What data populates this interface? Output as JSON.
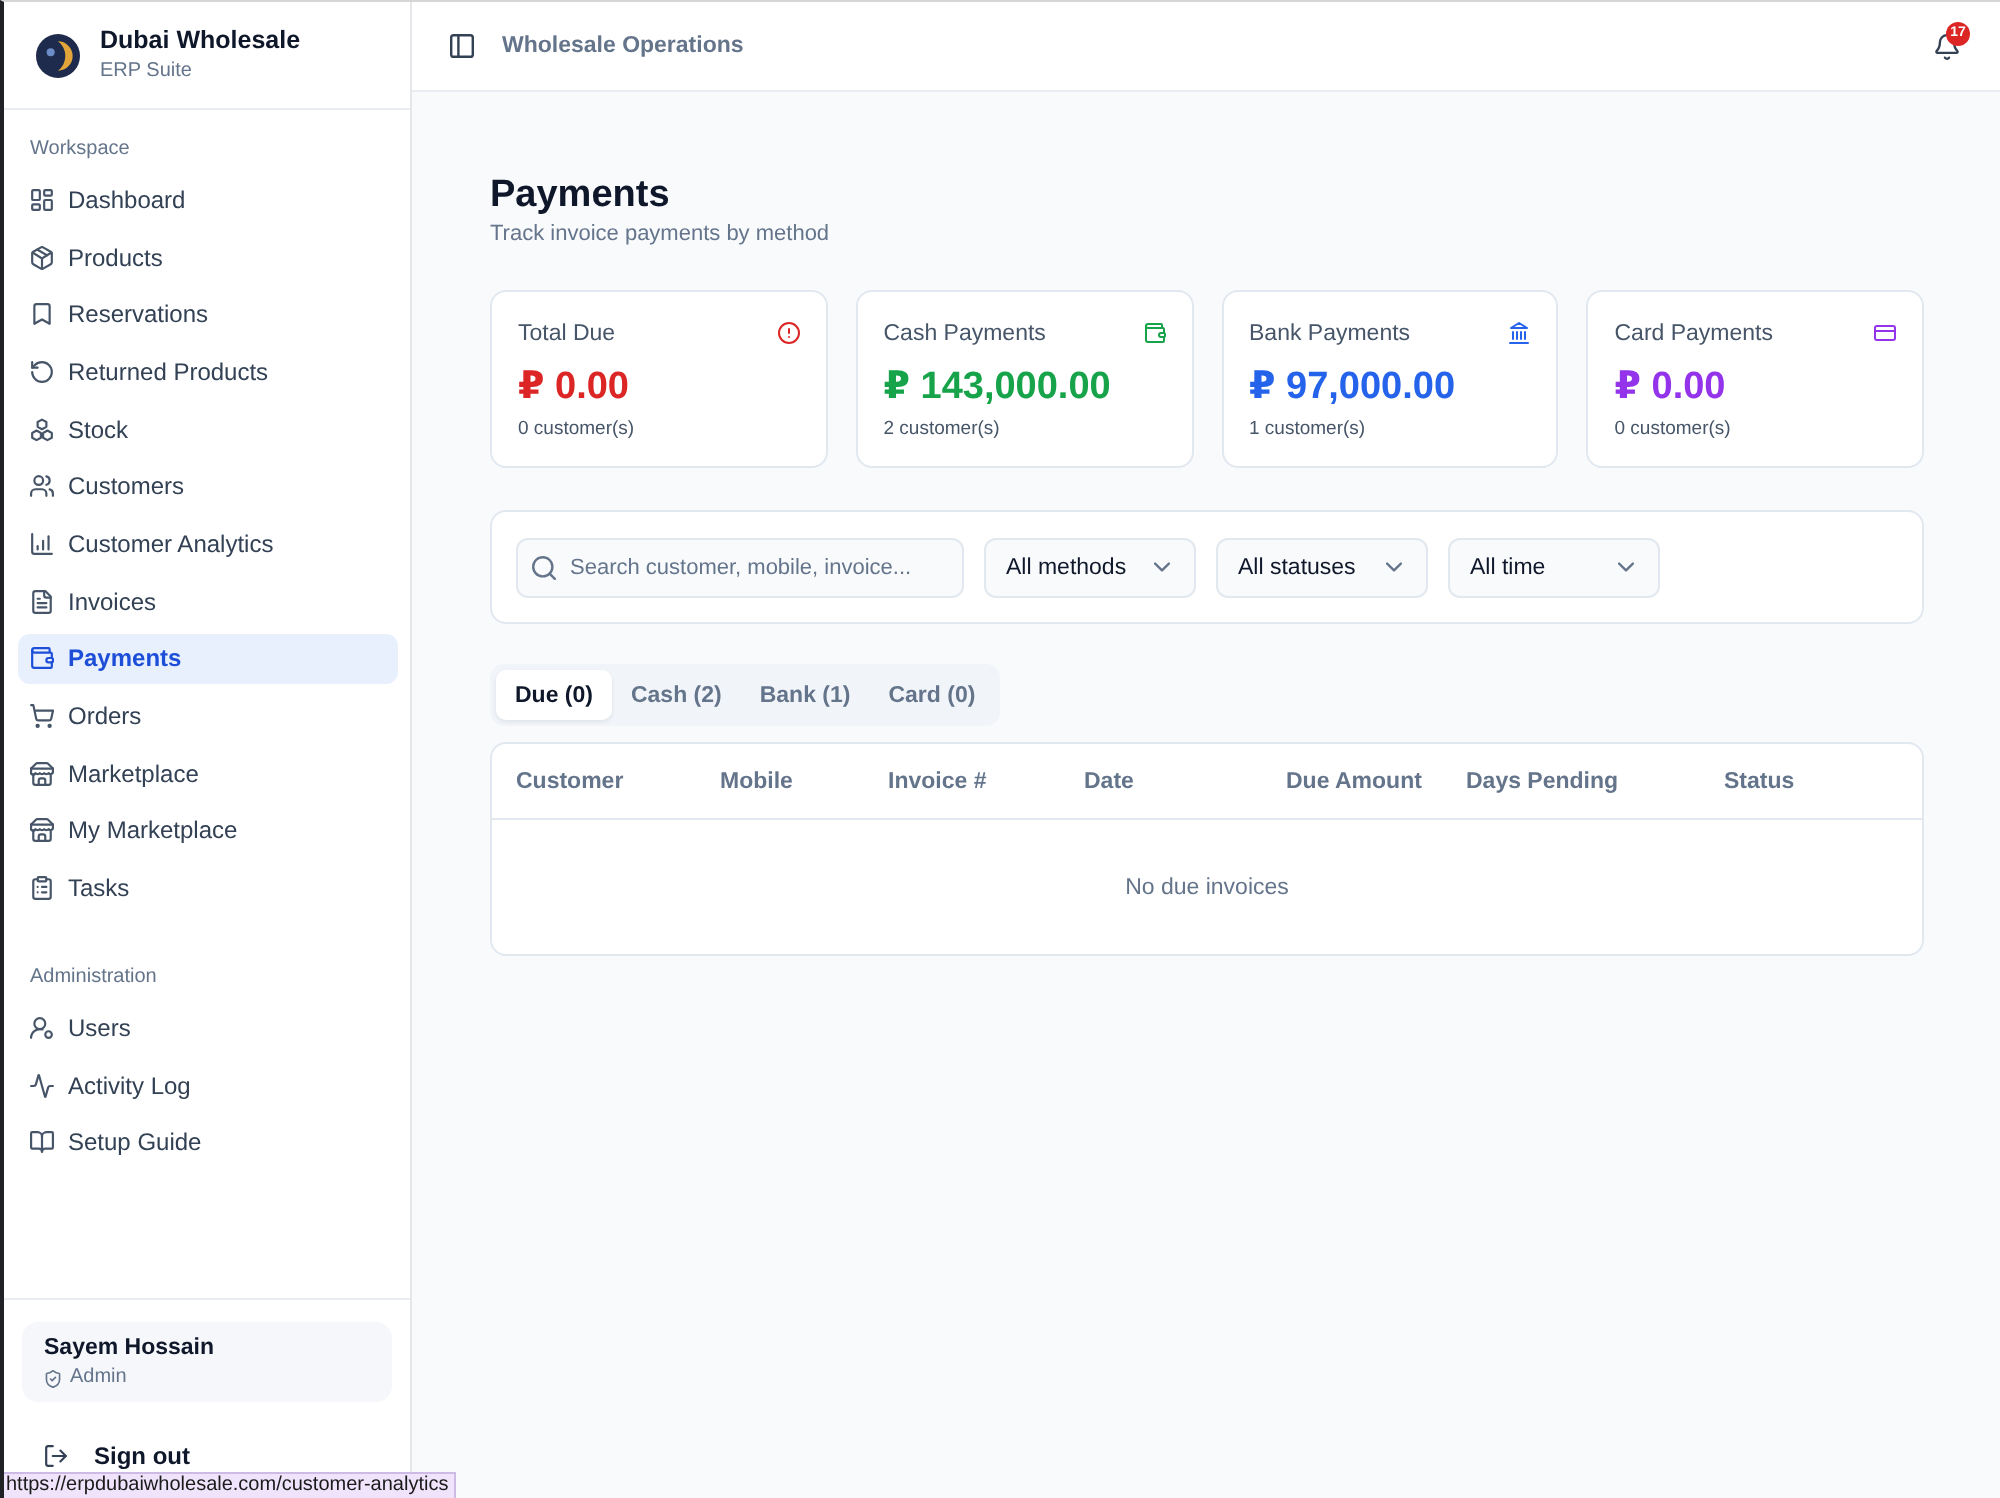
{
  "sidebar": {
    "brand": {
      "name": "Dubai Wholesale",
      "subtitle": "ERP Suite"
    },
    "sections": [
      {
        "title": "Workspace",
        "items": [
          {
            "label": "Dashboard",
            "selected": false
          },
          {
            "label": "Products",
            "selected": false
          },
          {
            "label": "Reservations",
            "selected": false
          },
          {
            "label": "Returned Products",
            "selected": false
          },
          {
            "label": "Stock",
            "selected": false
          },
          {
            "label": "Customers",
            "selected": false
          },
          {
            "label": "Customer Analytics",
            "selected": false
          },
          {
            "label": "Invoices",
            "selected": false
          },
          {
            "label": "Payments",
            "selected": true
          },
          {
            "label": "Orders",
            "selected": false
          },
          {
            "label": "Marketplace",
            "selected": false
          },
          {
            "label": "My Marketplace",
            "selected": false
          },
          {
            "label": "Tasks",
            "selected": false
          }
        ]
      },
      {
        "title": "Administration",
        "items": [
          {
            "label": "Users",
            "selected": false
          },
          {
            "label": "Activity Log",
            "selected": false
          },
          {
            "label": "Setup Guide",
            "selected": false
          }
        ]
      }
    ],
    "user": {
      "name": "Sayem Hossain",
      "role": "Admin"
    },
    "sign_out": "Sign out"
  },
  "header": {
    "title": "Wholesale Operations",
    "notification_count": "17"
  },
  "page": {
    "title": "Payments",
    "subtitle": "Track invoice payments by method"
  },
  "stats": [
    {
      "label": "Total Due",
      "value": "₽ 0.00",
      "note": "0 customer(s)",
      "color": "#dc2626"
    },
    {
      "label": "Cash Payments",
      "value": "₽ 143,000.00",
      "note": "2 customer(s)",
      "color": "#16a34a"
    },
    {
      "label": "Bank Payments",
      "value": "₽ 97,000.00",
      "note": "1 customer(s)",
      "color": "#2563eb"
    },
    {
      "label": "Card Payments",
      "value": "₽ 0.00",
      "note": "0 customer(s)",
      "color": "#9333ea"
    }
  ],
  "filters": {
    "search": {
      "placeholder": "Search customer, mobile, invoice..."
    },
    "dropdowns": [
      {
        "value": "All methods"
      },
      {
        "value": "All statuses"
      },
      {
        "value": "All time"
      }
    ]
  },
  "tabs": [
    {
      "label": "Due (0)",
      "selected": true
    },
    {
      "label": "Cash (2)",
      "selected": false
    },
    {
      "label": "Bank (1)",
      "selected": false
    },
    {
      "label": "Card (0)",
      "selected": false
    }
  ],
  "table": {
    "columns": [
      "Customer",
      "Mobile",
      "Invoice #",
      "Date",
      "Due Amount",
      "Days Pending",
      "Status"
    ],
    "empty_message": "No due invoices"
  },
  "status_bar": {
    "url": "https://erpdubaiwholesale.com/customer-analytics"
  }
}
